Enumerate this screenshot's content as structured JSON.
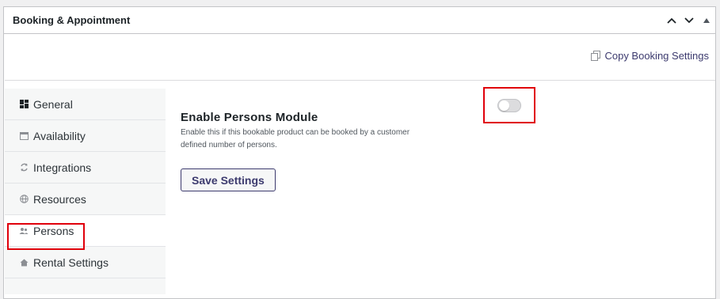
{
  "panel": {
    "title": "Booking & Appointment",
    "actions": [
      "move-up",
      "move-down",
      "toggle-panel"
    ]
  },
  "copy_settings": {
    "label": "Copy Booking Settings",
    "icon": "copy-icon"
  },
  "tabs": [
    {
      "label": "General",
      "icon": "dashboard-icon",
      "active": false
    },
    {
      "label": "Availability",
      "icon": "calendar-icon",
      "active": false
    },
    {
      "label": "Integrations",
      "icon": "sync-icon",
      "active": false
    },
    {
      "label": "Resources",
      "icon": "globe-icon",
      "active": false
    },
    {
      "label": "Persons",
      "icon": "persons-icon",
      "active": true
    },
    {
      "label": "Rental Settings",
      "icon": "home-icon",
      "active": false
    }
  ],
  "persons": {
    "field_title": "Enable Persons Module",
    "field_description": "Enable this if this bookable product can be booked by a customer defined number of persons.",
    "toggle_on": false,
    "save_label": "Save Settings"
  },
  "colors": {
    "accent": "#3c3a6e",
    "highlight": "#e0000b",
    "tab_bg": "#f6f7f7"
  }
}
